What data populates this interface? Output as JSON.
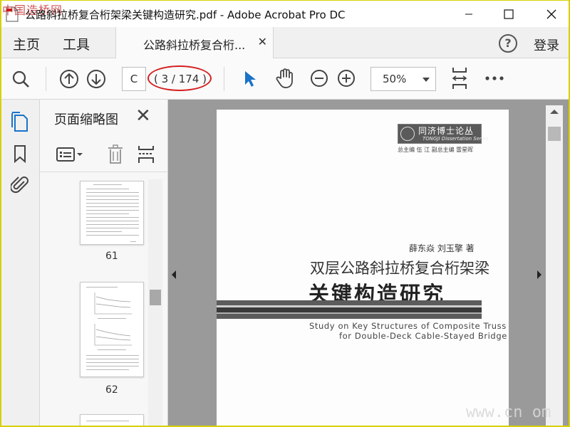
{
  "window": {
    "title": "公路斜拉桥复合桁架梁关键构造研究.pdf - Adobe Acrobat Pro DC",
    "corner_watermark": "中国造桥网"
  },
  "tabs": {
    "home": "主页",
    "tools": "工具",
    "document": "公路斜拉桥复合桁...",
    "login": "登录",
    "help": "?"
  },
  "toolbar": {
    "page_input": "C",
    "page_count": "( 3 / 174 )",
    "zoom": "50%"
  },
  "thumbnail_panel": {
    "title": "页面缩略图",
    "pages": [
      {
        "label": "61"
      },
      {
        "label": "62"
      }
    ]
  },
  "document": {
    "series_name": "同济博士论丛",
    "series_subtitle": "TONGJI Dissertation Series",
    "editors": "总主编  伍 江    副总主编  雷星晖",
    "authors": "薛东焱  刘玉擎  著",
    "title_line1": "双层公路斜拉桥复合桁架梁",
    "title_line2": "关键构造研究",
    "en_title_line1": "Study on Key Structures of Composite Truss",
    "en_title_line2": "for Double-Deck Cable-Stayed Bridge"
  },
  "site_watermark": "www.cn    om",
  "colors": {
    "accent_blue": "#1a73c8",
    "annotation_red": "#d42020",
    "frame_yellow": "#d8d000"
  }
}
